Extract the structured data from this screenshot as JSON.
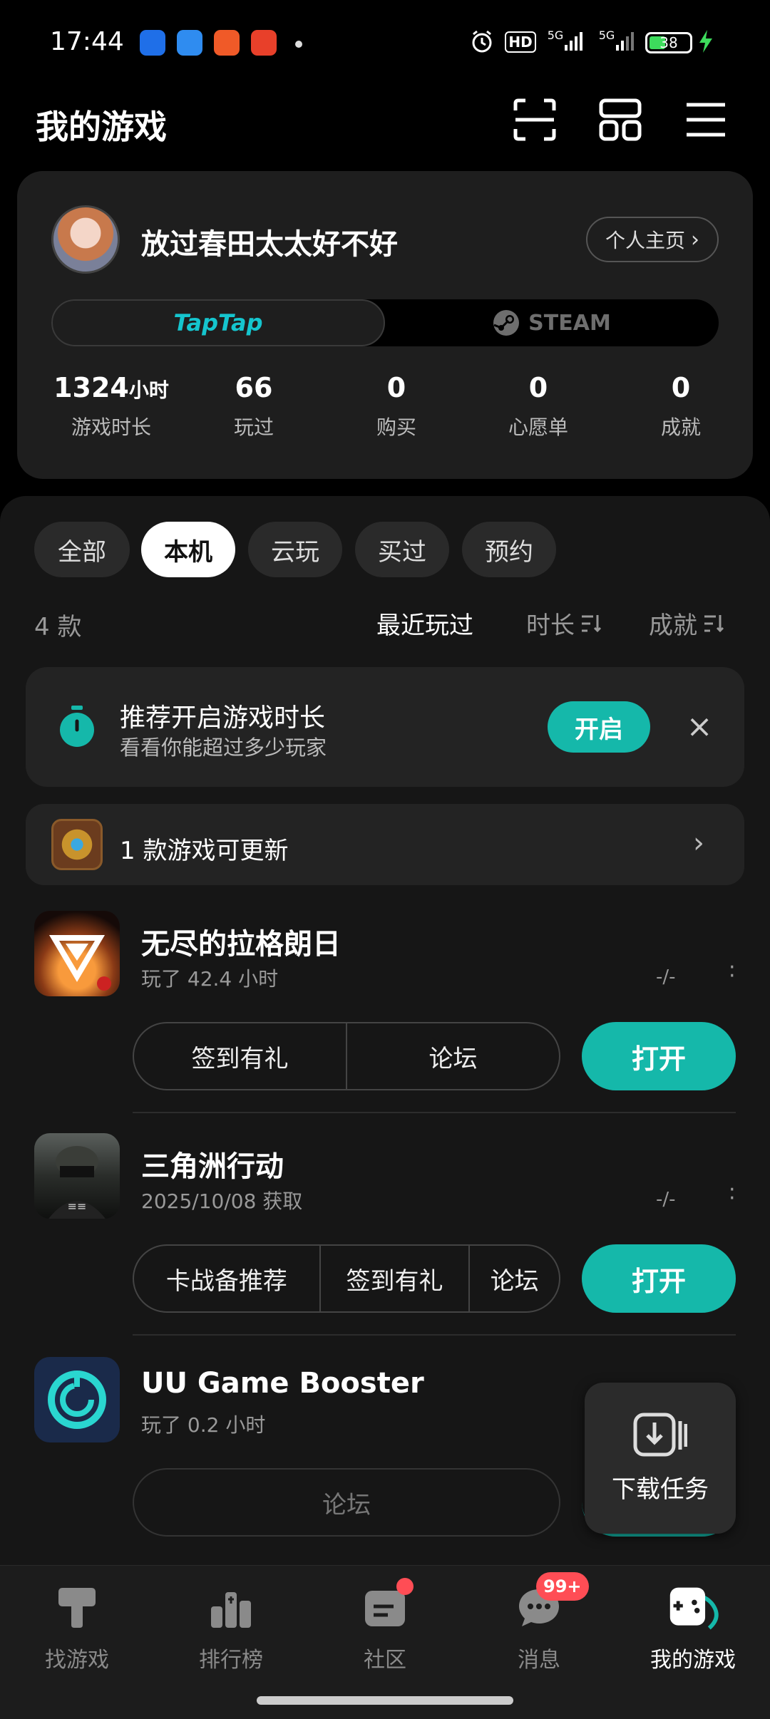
{
  "status_bar": {
    "time": "17:44",
    "battery": "38",
    "hd_label": "HD",
    "net1": "5G",
    "net2": "5G"
  },
  "header": {
    "title": "我的游戏",
    "icons": [
      "scan-icon",
      "layout-icon",
      "menu-icon"
    ]
  },
  "profile": {
    "username": "放过春田太太好不好",
    "homepage_button": "个人主页",
    "platforms": [
      "TapTap",
      "STEAM"
    ],
    "stats": [
      {
        "value": "1324",
        "unit": "小时",
        "label": "游戏时长"
      },
      {
        "value": "66",
        "unit": "",
        "label": "玩过"
      },
      {
        "value": "0",
        "unit": "",
        "label": "购买"
      },
      {
        "value": "0",
        "unit": "",
        "label": "心愿单"
      },
      {
        "value": "0",
        "unit": "",
        "label": "成就"
      }
    ]
  },
  "filters": {
    "tabs": [
      "全部",
      "本机",
      "云玩",
      "买过",
      "预约"
    ],
    "active": "本机",
    "count": "4 款",
    "sorts": [
      "最近玩过",
      "时长",
      "成就"
    ]
  },
  "recommend": {
    "title": "推荐开启游戏时长",
    "subtitle": "看看你能超过多少玩家",
    "button": "开启",
    "close": "×"
  },
  "update_banner": {
    "text": "1 款游戏可更新"
  },
  "games": [
    {
      "name": "无尽的拉格朗日",
      "sub": "玩了 42.4 小时",
      "dash": "-/-",
      "actions": [
        "签到有礼",
        "论坛"
      ],
      "open": "打开"
    },
    {
      "name": "三角洲行动",
      "sub": "2025/10/08 获取",
      "dash": "-/-",
      "actions": [
        "卡战备推荐",
        "签到有礼",
        "论坛"
      ],
      "open": "打开"
    },
    {
      "name": "UU Game Booster",
      "sub": "玩了 0.2 小时",
      "actions": [
        "论坛"
      ]
    }
  ],
  "download_task": {
    "label": "下载任务"
  },
  "bottom_nav": {
    "items": [
      "找游戏",
      "排行榜",
      "社区",
      "消息",
      "我的游戏"
    ],
    "active": "我的游戏",
    "message_badge": "99+"
  },
  "colors": {
    "accent": "#15b8aa",
    "taptap": "#15c5ce",
    "badge": "#ff4d55"
  }
}
